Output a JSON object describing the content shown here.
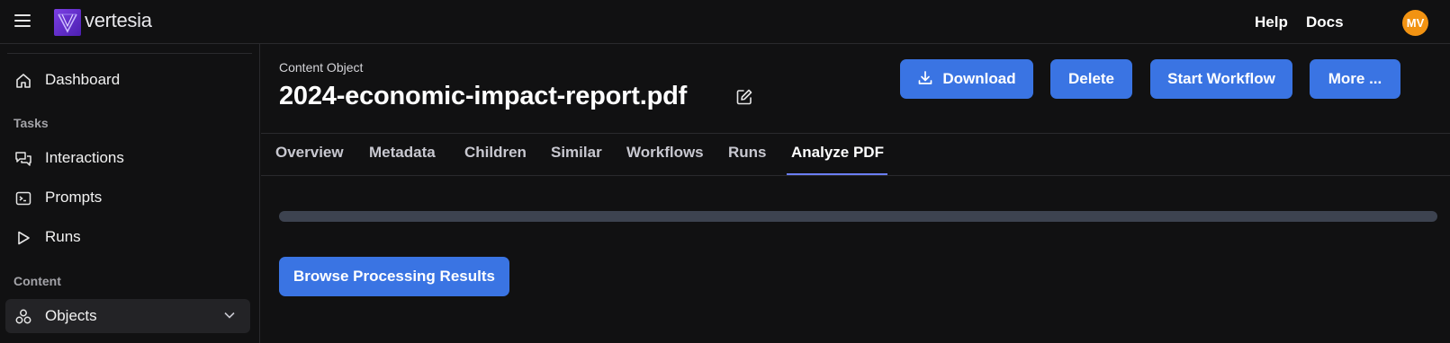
{
  "app": {
    "logo_text": "vertesia",
    "brand_color": "#6a35d9"
  },
  "topbar": {
    "help_label": "Help",
    "docs_label": "Docs",
    "avatar_initials": "MV",
    "avatar_color": "#f29312"
  },
  "sidebar": {
    "dashboard_label": "Dashboard",
    "tasks_section": "Tasks",
    "interactions_label": "Interactions",
    "prompts_label": "Prompts",
    "runs_label": "Runs",
    "content_section": "Content",
    "objects_label": "Objects"
  },
  "main": {
    "object_type": "Content Object",
    "title": "2024-economic-impact-report.pdf",
    "actions": {
      "download": "Download",
      "delete": "Delete",
      "start_workflow": "Start Workflow",
      "more": "More ..."
    },
    "tabs": {
      "overview": "Overview",
      "metadata": "Metadata",
      "children": "Children",
      "similar": "Similar",
      "workflows": "Workflows",
      "runs": "Runs",
      "analyze_pdf": "Analyze PDF"
    },
    "active_tab": "Analyze PDF",
    "progress_fraction": 1.0,
    "browse_results_label": "Browse Processing Results"
  },
  "colors": {
    "accent": "#3a74e3",
    "tab_indicator": "#6b7ef2",
    "background": "#111112"
  }
}
